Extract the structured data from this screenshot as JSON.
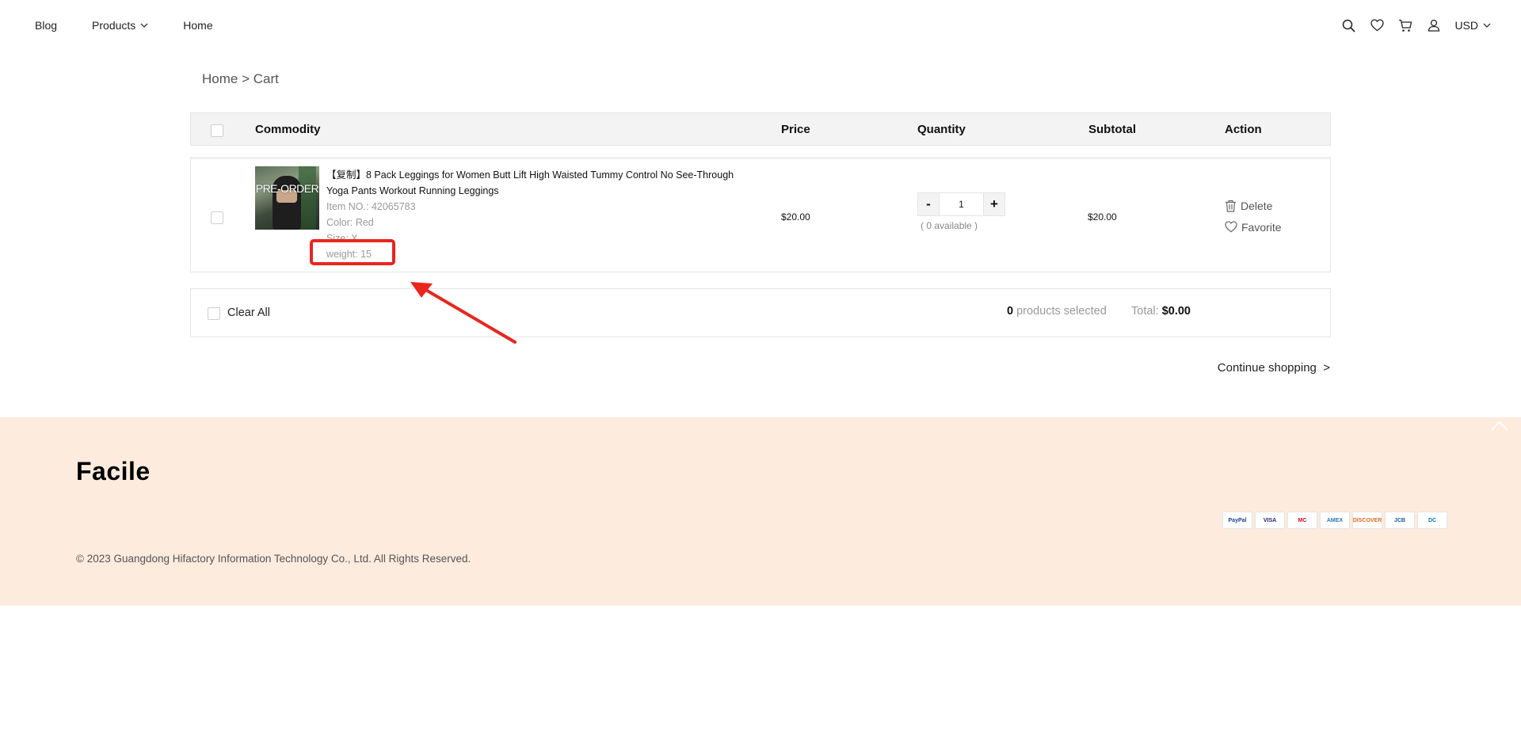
{
  "header": {
    "nav": [
      {
        "label": "Blog"
      },
      {
        "label": "Products",
        "has_dropdown": true
      },
      {
        "label": "Home"
      }
    ],
    "icons": [
      "search-icon",
      "heart-icon",
      "cart-icon",
      "user-icon"
    ],
    "currency": "USD"
  },
  "breadcrumb": {
    "home": "Home",
    "separator": ">",
    "current": "Cart"
  },
  "table": {
    "headers": {
      "commodity": "Commodity",
      "price": "Price",
      "quantity": "Quantity",
      "subtotal": "Subtotal",
      "action": "Action"
    },
    "items": [
      {
        "thumb_label": "PRE-ORDER",
        "title": "【复制】8 Pack Leggings for Women Butt Lift High Waisted Tummy Control No See-Through Yoga Pants Workout Running Leggings",
        "item_no": "Item NO.: 42065783",
        "color": "Color: Red",
        "size": "Size: X",
        "weight": "weight: 15",
        "price": "$20.00",
        "quantity": "1",
        "available": "( 0 available )",
        "subtotal": "$20.00",
        "delete_label": "Delete",
        "favorite_label": "Favorite"
      }
    ]
  },
  "summary": {
    "clear_all": "Clear All",
    "selected_count": "0",
    "selected_text": "products selected",
    "total_label": "Total:",
    "total_value": "$0.00",
    "continue": "Continue shopping",
    "continue_arrow": ">"
  },
  "footer": {
    "brand": "Facile",
    "copyright": "© 2023 Guangdong Hifactory Information Technology Co., Ltd. All Rights Reserved.",
    "payments": [
      "PayPal",
      "VISA",
      "MC",
      "AMEX",
      "DISCOVER",
      "JCB",
      "DC"
    ]
  },
  "colors": {
    "annotation": "#e8261e",
    "footer_bg": "#fdebde"
  }
}
